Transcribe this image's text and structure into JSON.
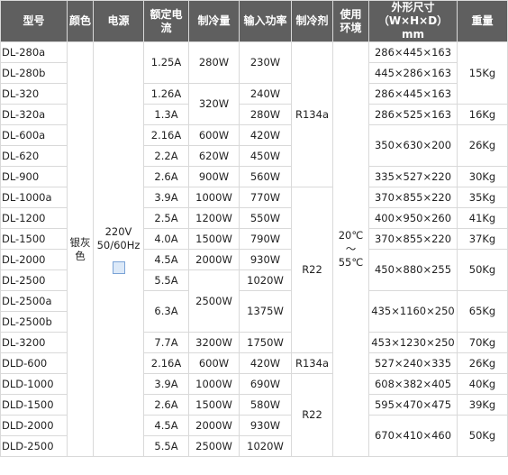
{
  "header": {
    "model": "型号",
    "color": "颜色",
    "power": "电源",
    "current": "额定电流",
    "cooling": "制冷量",
    "input_power": "输入功率",
    "refrigerant": "制冷剂",
    "environment": "使用环境",
    "dimensions": "外形尺寸 （W×H×D）mm",
    "weight": "重量"
  },
  "shared": {
    "color": "银灰色",
    "power_line1": "220V",
    "power_line2": "50/60Hz",
    "environment": "20℃～55℃"
  },
  "models": [
    "DL-280a",
    "DL-280b",
    "DL-320",
    "DL-320a",
    "DL-600a",
    "DL-620",
    "DL-900",
    "DL-1000a",
    "DL-1200",
    "DL-1500",
    "DL-2000",
    "DL-2500",
    "DL-2500a",
    "DL-2500b",
    "DL-3200",
    "DLD-600",
    "DLD-1000",
    "DLD-1500",
    "DLD-2000",
    "DLD-2500"
  ],
  "current": [
    "1.25A",
    "1.26A",
    "1.3A",
    "2.16A",
    "2.2A",
    "2.6A",
    "3.9A",
    "2.5A",
    "4.0A",
    "4.5A",
    "5.5A",
    "6.3A",
    "7.7A",
    "2.16A",
    "3.9A",
    "2.6A",
    "4.5A",
    "5.5A"
  ],
  "cooling": [
    "280W",
    "320W",
    "600W",
    "620W",
    "900W",
    "1000W",
    "1200W",
    "1500W",
    "2000W",
    "2500W",
    "3200W",
    "600W",
    "1000W",
    "1500W",
    "2000W",
    "2500W"
  ],
  "input_power": [
    "230W",
    "240W",
    "280W",
    "420W",
    "450W",
    "560W",
    "770W",
    "550W",
    "790W",
    "930W",
    "1020W",
    "1375W",
    "1750W",
    "420W",
    "690W",
    "580W",
    "930W",
    "1020W"
  ],
  "refrigerant": [
    "R134a",
    "R22",
    "R134a",
    "R22"
  ],
  "dimensions": [
    "286×445×163",
    "445×286×163",
    "286×445×163",
    "286×525×163",
    "350×630×200",
    "335×527×220",
    "370×855×220",
    "400×950×260",
    "370×855×220",
    "450×880×255",
    "435×1160×250",
    "453×1230×250",
    "527×240×335",
    "608×382×405",
    "595×470×475",
    "670×410×460"
  ],
  "weight": [
    "15Kg",
    "16Kg",
    "26Kg",
    "30Kg",
    "35Kg",
    "41Kg",
    "37Kg",
    "50Kg",
    "65Kg",
    "70Kg",
    "26Kg",
    "40Kg",
    "39Kg",
    "50Kg"
  ]
}
